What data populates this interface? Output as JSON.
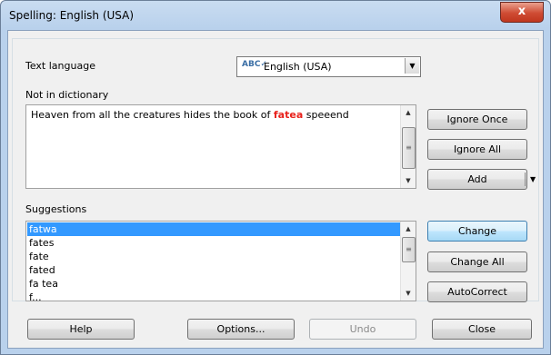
{
  "window": {
    "title": "Spelling: English (USA)",
    "close_label": "x"
  },
  "text_language": {
    "label": "Text language",
    "value": "English (USA)",
    "icon": "spellcheck-icon"
  },
  "not_in_dictionary": {
    "label": "Not in dictionary",
    "sentence_before": "Heaven from all the creatures hides the book of ",
    "error_word": "fatea",
    "sentence_after": " speeend"
  },
  "suggestions": {
    "label": "Suggestions",
    "items": [
      "fatwa",
      "fates",
      "fate",
      "fated",
      "fa tea",
      "f..."
    ],
    "selected": "fatwa"
  },
  "buttons": {
    "ignore_once": "Ignore Once",
    "ignore_all": "Ignore All",
    "add": "Add",
    "change": "Change",
    "change_all": "Change All",
    "autocorrect": "AutoCorrect",
    "help": "Help",
    "options": "Options...",
    "undo": "Undo",
    "close": "Close"
  },
  "colors": {
    "error_word": "#e8211b",
    "selection": "#3399ff",
    "close_button": "#cf4b33"
  }
}
